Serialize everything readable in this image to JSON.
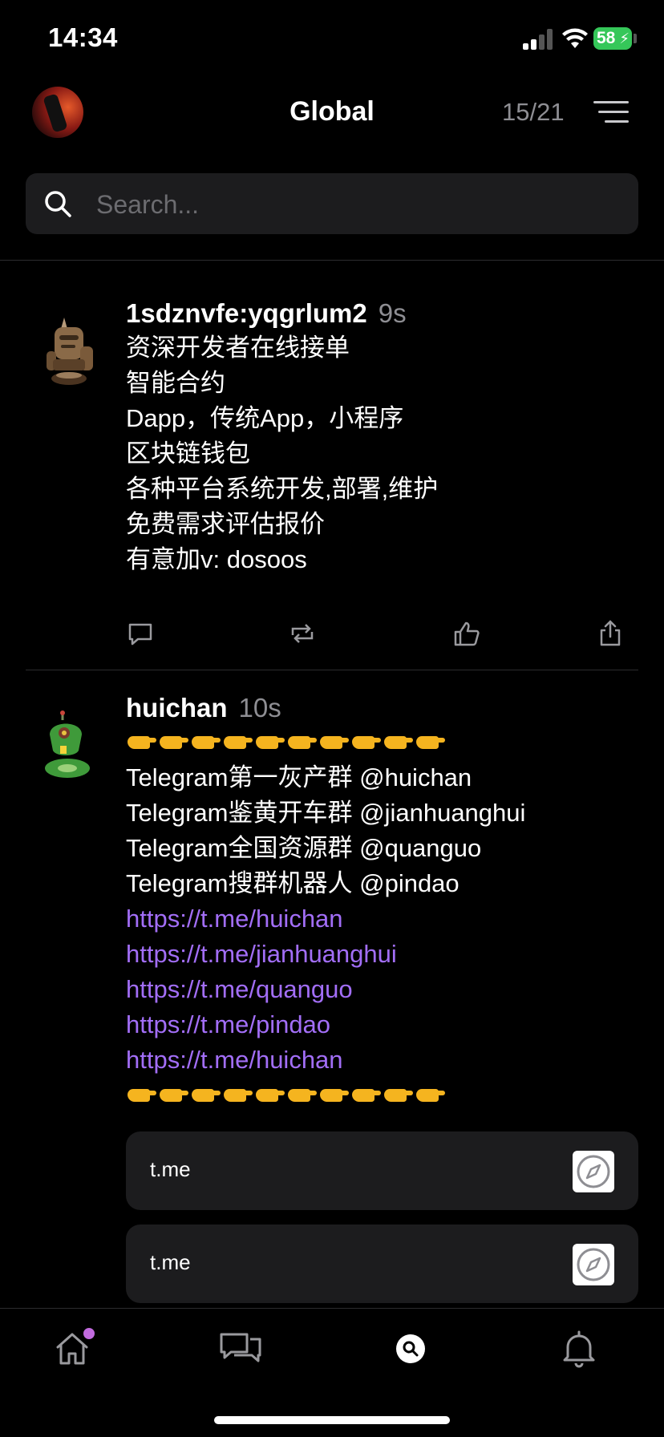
{
  "status_bar": {
    "time": "14:34",
    "battery": "58"
  },
  "header": {
    "title": "Global",
    "counter": "15/21"
  },
  "search": {
    "placeholder": "Search..."
  },
  "posts": [
    {
      "author": "1sdznvfe:yqgrlum2",
      "time": "9s",
      "lines": [
        "资深开发者在线接单",
        "智能合约",
        "Dapp，传统App，小程序",
        "区块链钱包",
        "各种平台系统开发,部署,维护",
        "免费需求评估报价",
        "有意加v: dosoos"
      ]
    },
    {
      "author": "huichan",
      "time": "10s",
      "lines": [
        "Telegram第一灰产群 @huichan",
        "Telegram鉴黄开车群 @jianhuanghui",
        "Telegram全国资源群 @quanguo",
        "Telegram搜群机器人 @pindao"
      ],
      "links": [
        "https://t.me/huichan",
        "https://t.me/jianhuanghui",
        "https://t.me/quanguo",
        "https://t.me/pindao",
        "https://t.me/huichan"
      ],
      "link_cards": [
        "t.me",
        "t.me"
      ]
    }
  ],
  "icons": {
    "pointing_emoji": "backhand-index-pointing-right",
    "tabs": [
      "home-icon",
      "messages-icon",
      "search-icon",
      "bell-icon"
    ]
  },
  "colors": {
    "background": "#000000",
    "link": "#a26ef7",
    "muted": "#8e8e93",
    "card": "#1c1c1e",
    "badge": "#c26bde",
    "battery": "#35c759"
  }
}
